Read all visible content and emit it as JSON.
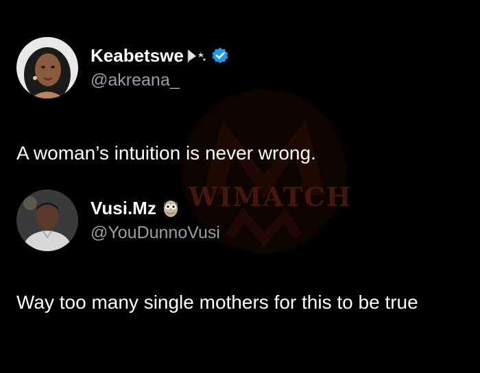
{
  "tweet": {
    "display_name": "Keabetswe",
    "handle": "@akreana_",
    "text": "A woman’s intuition is never wrong.",
    "verified": true,
    "name_emoji_icon": "pennant-sparkle-icon"
  },
  "reply": {
    "display_name": "Vusi.Mz",
    "handle": "@YouDunnoVusi",
    "text": "Way too many single mothers for this to be true",
    "name_emoji_icon": "owl-icon"
  },
  "watermark": {
    "text": "WIMATCH"
  },
  "colors": {
    "background": "#000000",
    "handle": "#9a9fa5",
    "verified_badge": "#1d9bf0",
    "watermark": "#5a1a0a"
  }
}
